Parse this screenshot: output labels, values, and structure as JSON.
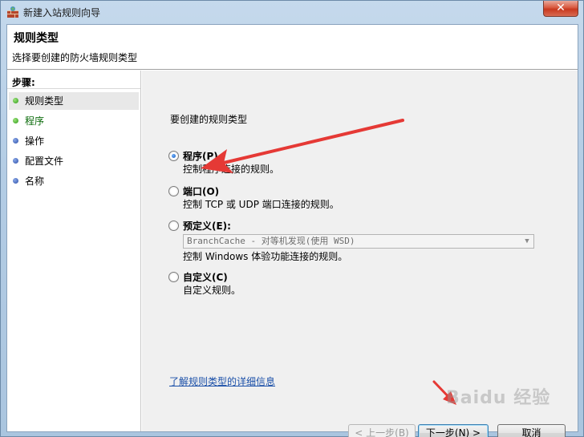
{
  "window": {
    "title": "新建入站规则向导",
    "close_glyph": "✕"
  },
  "header": {
    "title": "规则类型",
    "subtitle": "选择要创建的防火墙规则类型"
  },
  "steps": {
    "heading": "步骤:",
    "items": [
      {
        "label": "规则类型",
        "state": "current"
      },
      {
        "label": "程序",
        "state": "done"
      },
      {
        "label": "操作",
        "state": "pending"
      },
      {
        "label": "配置文件",
        "state": "pending"
      },
      {
        "label": "名称",
        "state": "pending"
      }
    ]
  },
  "content": {
    "question": "要创建的规则类型",
    "options": [
      {
        "label": "程序(P)",
        "description": "控制程序连接的规则。",
        "checked": true
      },
      {
        "label": "端口(O)",
        "description": "控制 TCP 或 UDP 端口连接的规则。",
        "checked": false
      },
      {
        "label": "预定义(E):",
        "description": "控制 Windows 体验功能连接的规则。",
        "checked": false
      },
      {
        "label": "自定义(C)",
        "description": "自定义规则。",
        "checked": false
      }
    ],
    "predefined_select_value": "BranchCache - 对等机发现(使用 WSD)",
    "learn_more_link": "了解规则类型的详细信息"
  },
  "buttons": {
    "back": "< 上一步(B)",
    "next": "下一步(N) >",
    "cancel": "取消"
  },
  "watermark": "Baidu 经验",
  "colors": {
    "annotation_arrow": "#e53935",
    "link": "#1a4fa8",
    "step_done": "#2f9a1a",
    "step_pending": "#2b4fa8"
  },
  "icons": {
    "window": "firewall-icon",
    "close": "close-icon",
    "dropdown": "chevron-down-icon"
  }
}
